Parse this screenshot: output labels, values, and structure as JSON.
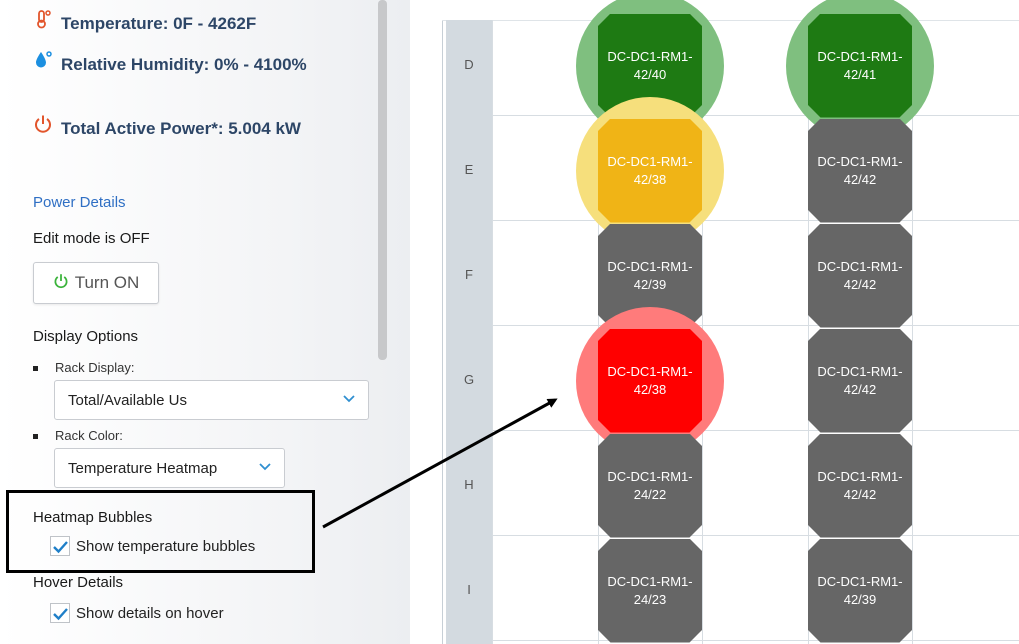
{
  "metrics": {
    "temperature": {
      "icon": "thermometer-icon",
      "label": "Temperature: 0F - 4262F"
    },
    "humidity": {
      "icon": "water-drop-icon",
      "label": "Relative Humidity: 0% - 4100%"
    },
    "power": {
      "icon": "power-icon",
      "label": "Total Active Power*: 5.004 kW"
    }
  },
  "power_details_link": "Power Details",
  "edit_mode": {
    "status": "Edit mode is OFF",
    "button_label": "Turn ON"
  },
  "display_options": {
    "title": "Display Options",
    "rack_display_label": "Rack Display:",
    "rack_display_value": "Total/Available Us",
    "rack_color_label": "Rack Color:",
    "rack_color_value": "Temperature Heatmap"
  },
  "heatmap_bubbles": {
    "title": "Heatmap Bubbles",
    "checkbox_label": "Show temperature bubbles",
    "checked": true
  },
  "hover_details": {
    "title": "Hover Details",
    "checkbox_label": "Show details on hover",
    "checked": true
  },
  "colors": {
    "green": "#1e7a13",
    "green_bubble": "#7fbf7f",
    "yellow": "#f0b416",
    "yellow_bubble": "#f6df7c",
    "red": "#ff0000",
    "red_bubble": "#ff7b7b",
    "grey": "#666666",
    "link": "#2f6fc4",
    "metric_text": "#2d4667"
  },
  "grid": {
    "rows": [
      {
        "label": "D",
        "racks": [
          {
            "line1": "DC-DC1-RM1-",
            "line2": "42/40",
            "color": "green",
            "bubble": true
          },
          {
            "line1": "DC-DC1-RM1-",
            "line2": "42/41",
            "color": "green",
            "bubble": true
          }
        ]
      },
      {
        "label": "E",
        "racks": [
          {
            "line1": "DC-DC1-RM1-",
            "line2": "42/38",
            "color": "yellow",
            "bubble": true
          },
          {
            "line1": "DC-DC1-RM1-",
            "line2": "42/42",
            "color": "grey",
            "bubble": false
          }
        ]
      },
      {
        "label": "F",
        "racks": [
          {
            "line1": "DC-DC1-RM1-",
            "line2": "42/39",
            "color": "grey",
            "bubble": false
          },
          {
            "line1": "DC-DC1-RM1-",
            "line2": "42/42",
            "color": "grey",
            "bubble": false
          }
        ]
      },
      {
        "label": "G",
        "racks": [
          {
            "line1": "DC-DC1-RM1-",
            "line2": "42/38",
            "color": "red",
            "bubble": true
          },
          {
            "line1": "DC-DC1-RM1-",
            "line2": "42/42",
            "color": "grey",
            "bubble": false
          }
        ]
      },
      {
        "label": "H",
        "racks": [
          {
            "line1": "DC-DC1-RM1-",
            "line2": "24/22",
            "color": "grey",
            "bubble": false
          },
          {
            "line1": "DC-DC1-RM1-",
            "line2": "42/42",
            "color": "grey",
            "bubble": false
          }
        ]
      },
      {
        "label": "I",
        "racks": [
          {
            "line1": "DC-DC1-RM1-",
            "line2": "24/23",
            "color": "grey",
            "bubble": false
          },
          {
            "line1": "DC-DC1-RM1-",
            "line2": "42/39",
            "color": "grey",
            "bubble": false
          }
        ]
      }
    ]
  }
}
